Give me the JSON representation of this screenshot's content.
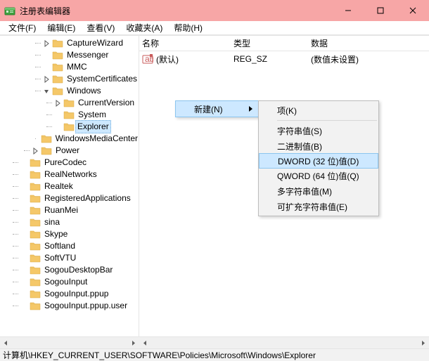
{
  "window": {
    "title": "注册表编辑器"
  },
  "menu": {
    "file": "文件(F)",
    "edit": "编辑(E)",
    "view": "查看(V)",
    "favorites": "收藏夹(A)",
    "help": "帮助(H)"
  },
  "tree": {
    "items": [
      {
        "level": 3,
        "toggle": "closed",
        "name": "CaptureWizard"
      },
      {
        "level": 3,
        "toggle": "none",
        "name": "Messenger"
      },
      {
        "level": 3,
        "toggle": "none",
        "name": "MMC"
      },
      {
        "level": 3,
        "toggle": "closed",
        "name": "SystemCertificates"
      },
      {
        "level": 3,
        "toggle": "open",
        "name": "Windows"
      },
      {
        "level": 4,
        "toggle": "closed",
        "name": "CurrentVersion"
      },
      {
        "level": 4,
        "toggle": "none",
        "name": "System"
      },
      {
        "level": 4,
        "toggle": "none",
        "name": "Explorer",
        "selected": true
      },
      {
        "level": 3,
        "toggle": "none",
        "name": "WindowsMediaCenter"
      },
      {
        "level": 2,
        "toggle": "closed",
        "name": "Power"
      },
      {
        "level": 1,
        "toggle": "none",
        "name": "PureCodec"
      },
      {
        "level": 1,
        "toggle": "none",
        "name": "RealNetworks"
      },
      {
        "level": 1,
        "toggle": "none",
        "name": "Realtek"
      },
      {
        "level": 1,
        "toggle": "none",
        "name": "RegisteredApplications"
      },
      {
        "level": 1,
        "toggle": "none",
        "name": "RuanMei"
      },
      {
        "level": 1,
        "toggle": "none",
        "name": "sina"
      },
      {
        "level": 1,
        "toggle": "none",
        "name": "Skype"
      },
      {
        "level": 1,
        "toggle": "none",
        "name": "Softland"
      },
      {
        "level": 1,
        "toggle": "none",
        "name": "SoftVTU"
      },
      {
        "level": 1,
        "toggle": "none",
        "name": "SogouDesktopBar"
      },
      {
        "level": 1,
        "toggle": "none",
        "name": "SogouInput"
      },
      {
        "level": 1,
        "toggle": "none",
        "name": "SogouInput.ppup"
      },
      {
        "level": 1,
        "toggle": "none",
        "name": "SogouInput.ppup.user"
      }
    ]
  },
  "list": {
    "header": {
      "name": "名称",
      "type": "类型",
      "data": "数据"
    },
    "rows": [
      {
        "name": "(默认)",
        "type": "REG_SZ",
        "data": "(数值未设置)"
      }
    ]
  },
  "context1": {
    "new": "新建(N)"
  },
  "context2": {
    "key": "项(K)",
    "string": "字符串值(S)",
    "binary": "二进制值(B)",
    "dword": "DWORD (32 位)值(D)",
    "qword": "QWORD (64 位)值(Q)",
    "multi": "多字符串值(M)",
    "expand": "可扩充字符串值(E)"
  },
  "status": {
    "path": "计算机\\HKEY_CURRENT_USER\\SOFTWARE\\Policies\\Microsoft\\Windows\\Explorer"
  }
}
